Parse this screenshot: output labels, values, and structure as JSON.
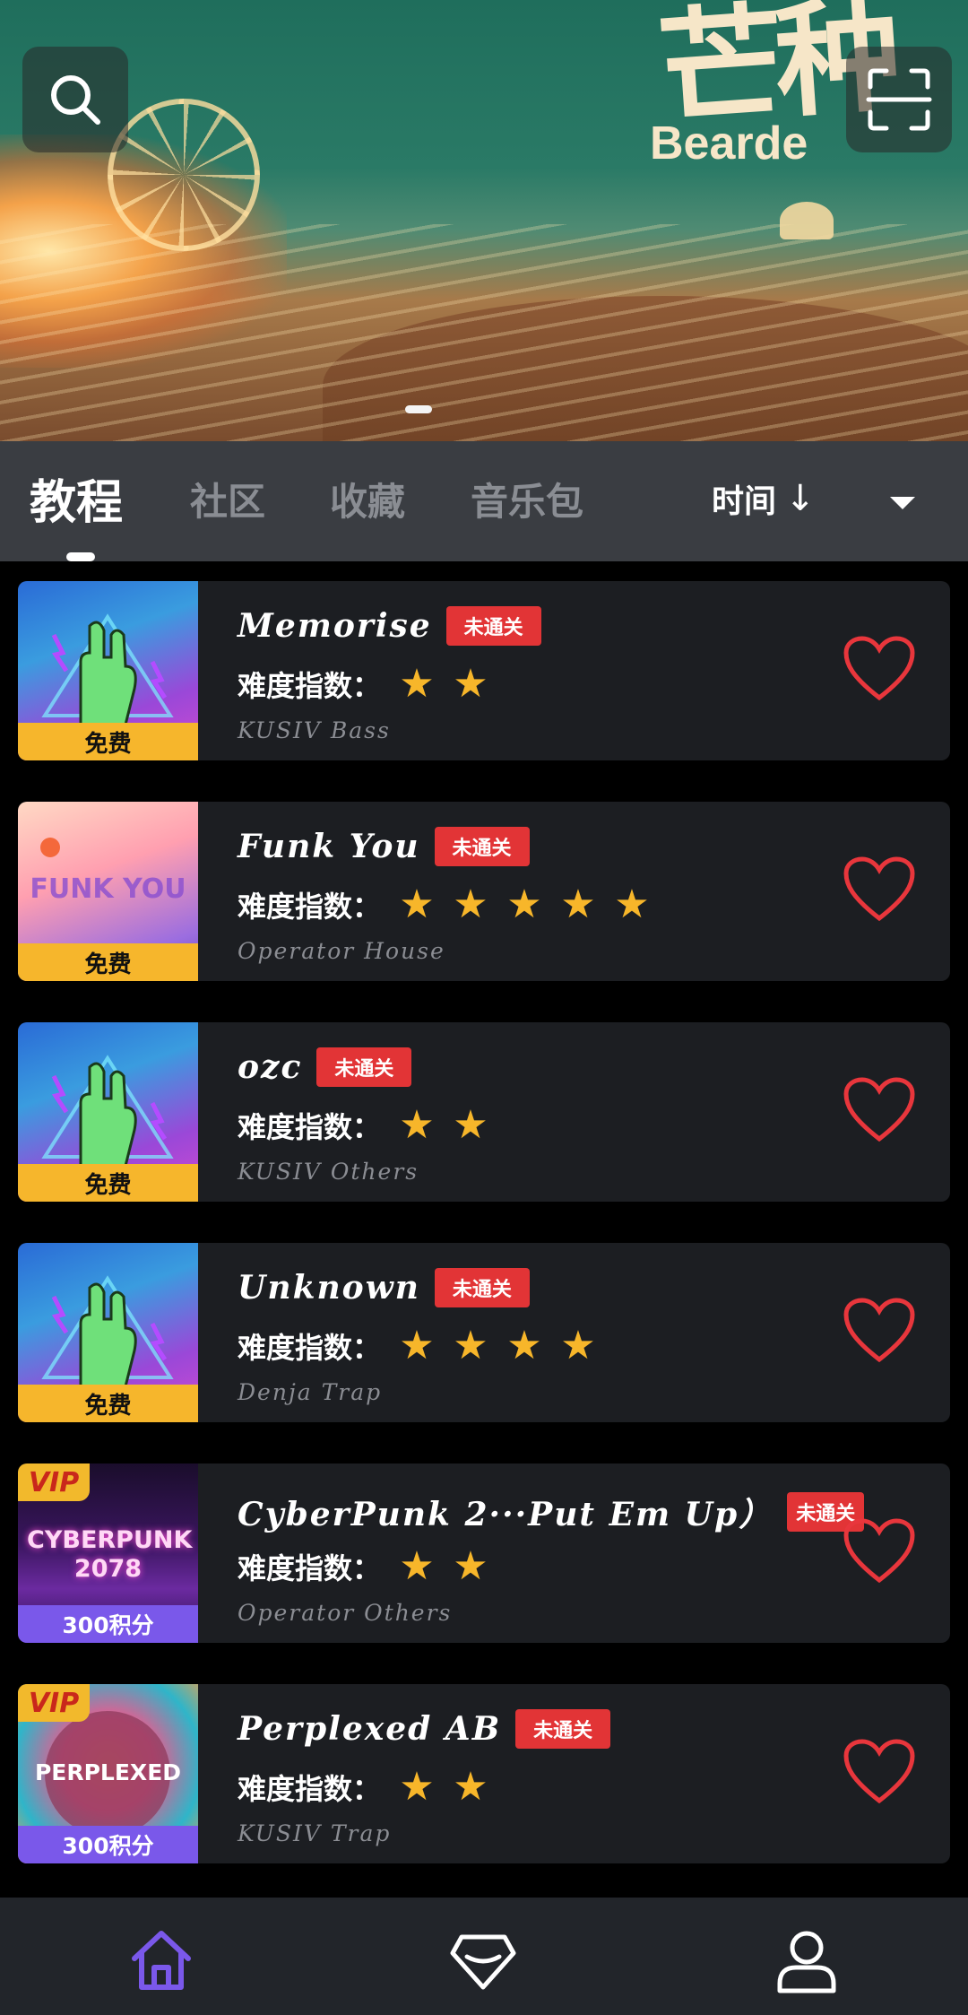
{
  "banner": {
    "title_cn": "芒种",
    "title_en": "Bearde",
    "search_icon": "search-icon",
    "scan_icon": "scan-icon"
  },
  "tabs": [
    {
      "label": "教程",
      "active": true
    },
    {
      "label": "社区",
      "active": false
    },
    {
      "label": "收藏",
      "active": false
    },
    {
      "label": "音乐包",
      "active": false
    }
  ],
  "sort": {
    "label": "时间",
    "arrow": "↓"
  },
  "difficulty_label": "难度指数：",
  "colors": {
    "accent_gold": "#f6b62c",
    "accent_purple": "#7a58ea",
    "badge_red": "#e23436",
    "heart_red": "#e8363c",
    "nav_active": "#7a58ea"
  },
  "songs": [
    {
      "title": "Memorise",
      "badge": "未通关",
      "stars": 2,
      "artist": "KUSIV",
      "genre": "Bass",
      "price": "免费",
      "vip": false,
      "art": "rock"
    },
    {
      "title": "Funk You",
      "badge": "未通关",
      "stars": 5,
      "artist": "Operator",
      "genre": "House",
      "price": "免费",
      "vip": false,
      "art": "funk",
      "art_text": "FUNK YOU"
    },
    {
      "title": "ozc",
      "badge": "未通关",
      "stars": 2,
      "artist": "KUSIV",
      "genre": "Others",
      "price": "免费",
      "vip": false,
      "art": "rock"
    },
    {
      "title": "Unknown",
      "badge": "未通关",
      "stars": 4,
      "artist": "Denja",
      "genre": "Trap",
      "price": "免费",
      "vip": false,
      "art": "rock"
    },
    {
      "title": "CyberPunk 2···Put Em Up）",
      "badge": "未通关",
      "stars": 2,
      "artist": "Operator",
      "genre": "Others",
      "price": "300积分",
      "vip": true,
      "vip_label": "VIP",
      "art": "cyber",
      "art_text": "CYBERPUNK 2078"
    },
    {
      "title": "Perplexed AB",
      "badge": "未通关",
      "stars": 2,
      "artist": "KUSIV",
      "genre": "Trap",
      "price": "300积分",
      "vip": true,
      "vip_label": "VIP",
      "art": "perplexed",
      "art_text": "PERPLEXED"
    }
  ],
  "bottom_nav": [
    {
      "name": "home",
      "icon": "home-icon",
      "active": true
    },
    {
      "name": "shop",
      "icon": "diamond-icon",
      "active": false
    },
    {
      "name": "profile",
      "icon": "user-icon",
      "active": false
    }
  ]
}
